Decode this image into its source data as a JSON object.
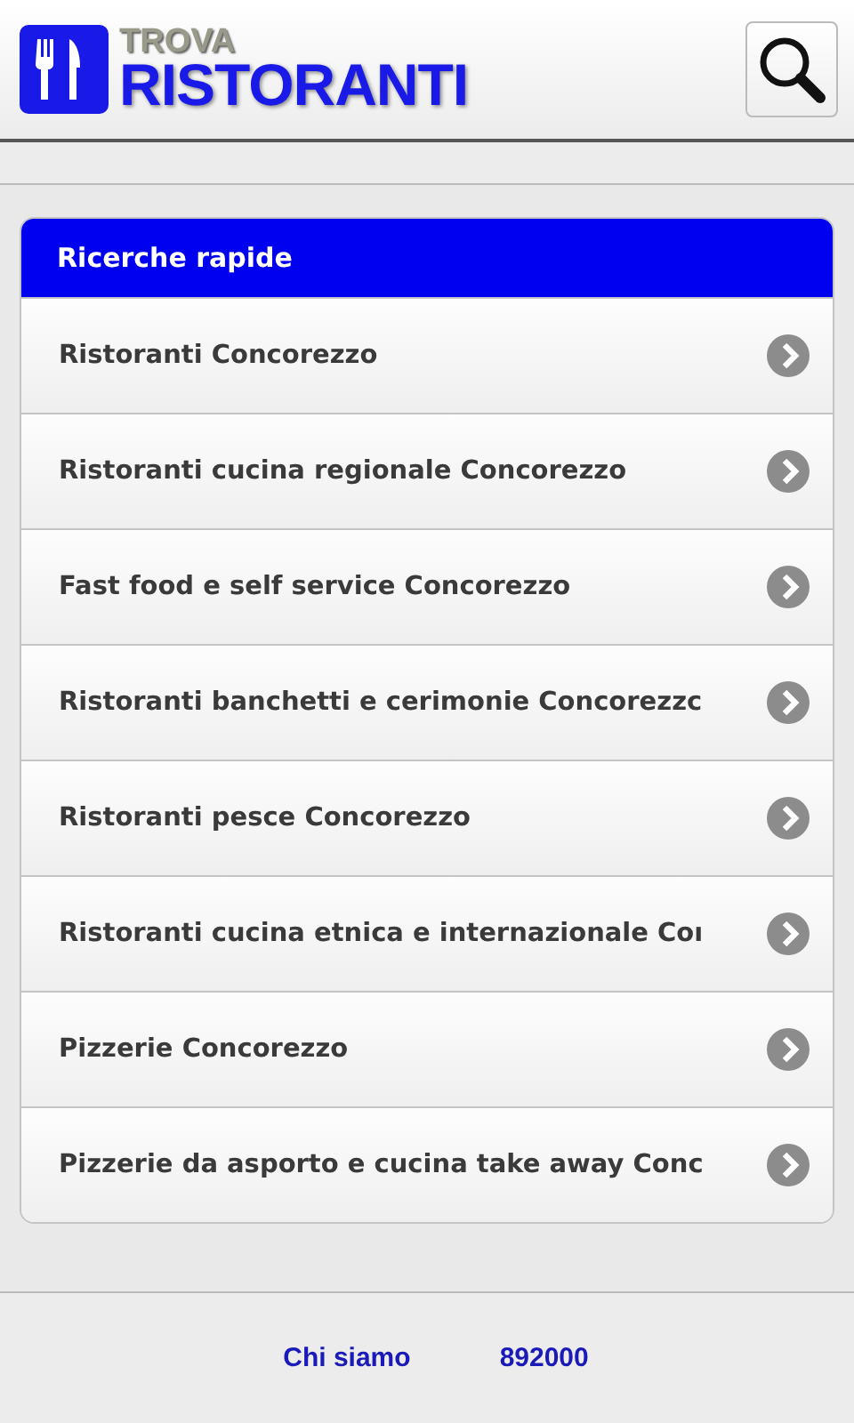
{
  "header": {
    "logo_top": "TROVA",
    "logo_main": "RISTORANTI"
  },
  "quick_search": {
    "title": "Ricerche rapide",
    "items": [
      {
        "label": "Ristoranti Concorezzo"
      },
      {
        "label": "Ristoranti cucina regionale Concorezzo"
      },
      {
        "label": "Fast food e self service Concorezzo"
      },
      {
        "label": "Ristoranti banchetti e cerimonie Concorezzc"
      },
      {
        "label": "Ristoranti pesce Concorezzo"
      },
      {
        "label": "Ristoranti cucina etnica e internazionale Coı"
      },
      {
        "label": "Pizzerie Concorezzo"
      },
      {
        "label": "Pizzerie da asporto e cucina take away Conc"
      }
    ]
  },
  "footer": {
    "links": [
      "Chi siamo",
      "892000"
    ]
  }
}
